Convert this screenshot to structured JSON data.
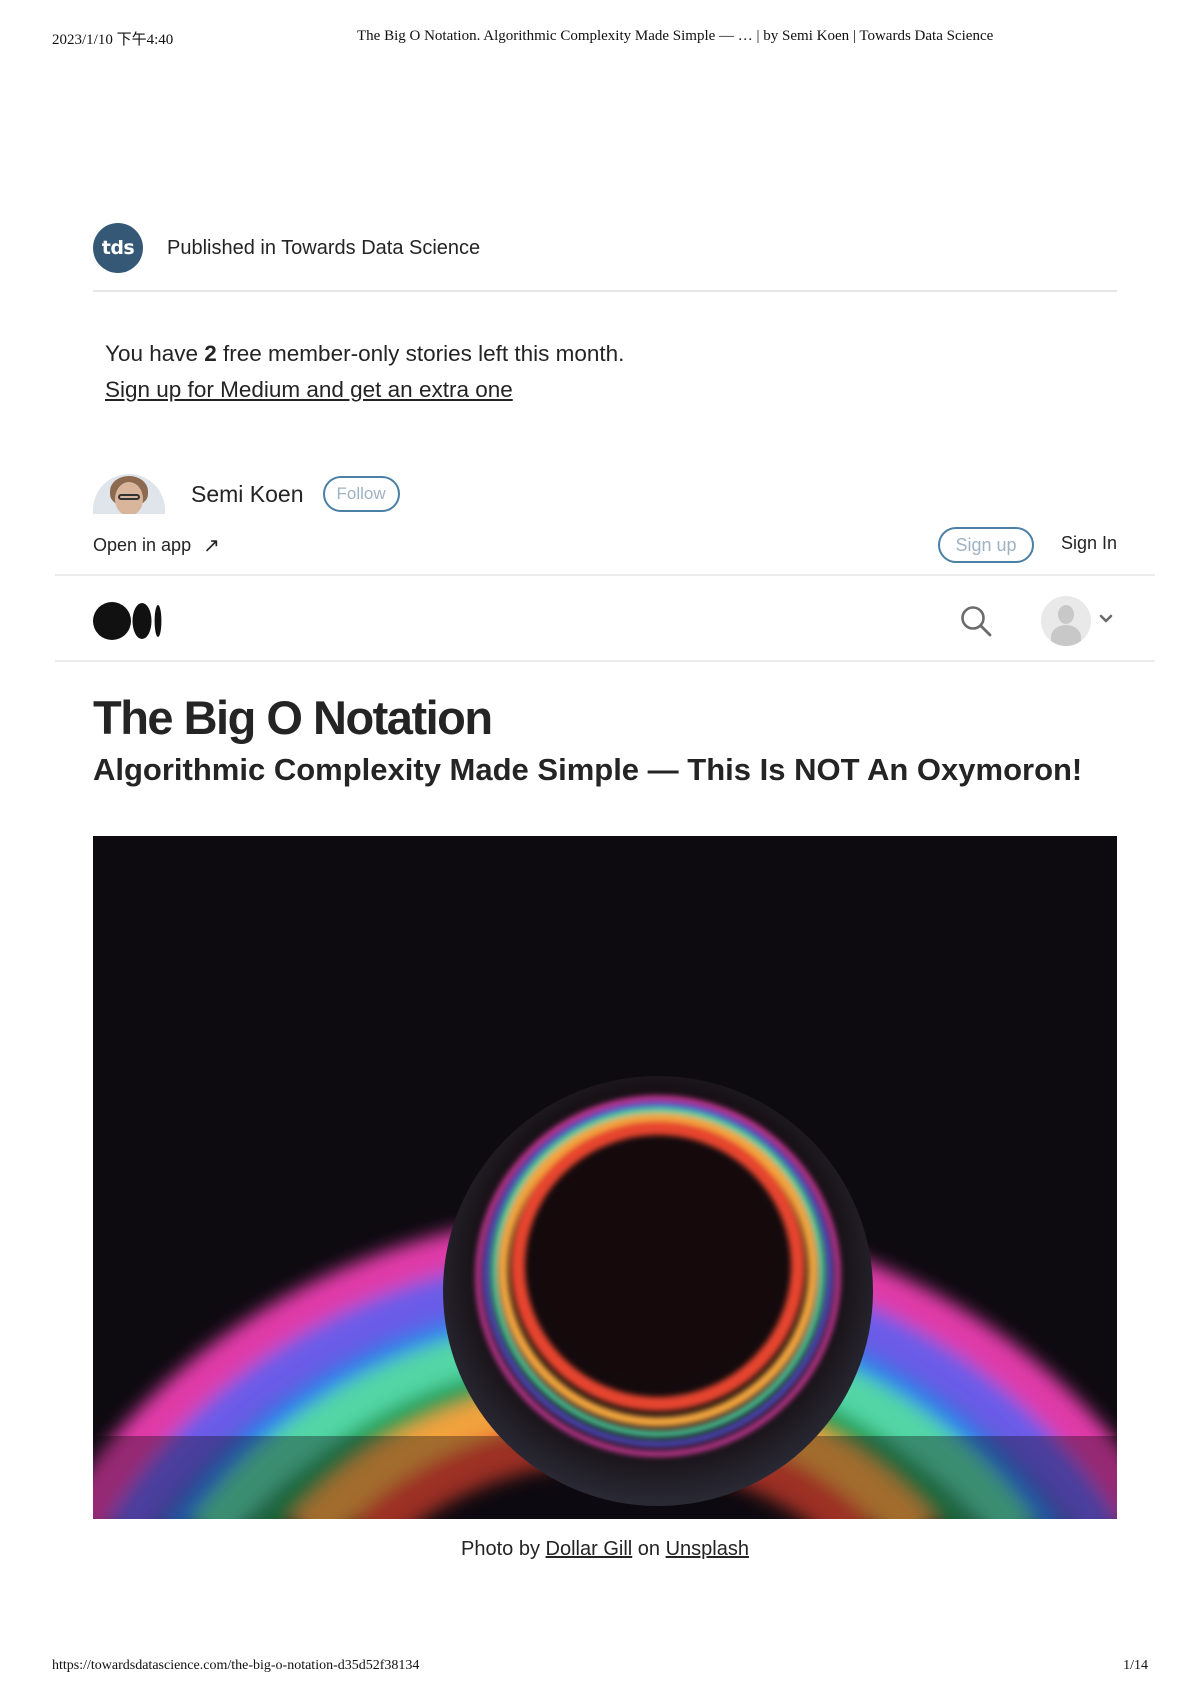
{
  "print_header": {
    "date": "2023/1/10 下午4:40",
    "document_title": "The Big O Notation. Algorithmic Complexity Made Simple — … | by Semi Koen | Towards Data Science"
  },
  "publication": {
    "logo_text": "tds",
    "published_in": "Published in Towards Data Science"
  },
  "paywall": {
    "prefix": "You have ",
    "count": "2",
    "suffix": " free member-only stories left this month.",
    "signup_link": "Sign up for Medium and get an extra one"
  },
  "author": {
    "name": "Semi Koen",
    "follow_label": "Follow"
  },
  "topbar": {
    "open_in_app": "Open in app",
    "arrow_glyph": "↗",
    "sign_up": "Sign up",
    "sign_in": "Sign In"
  },
  "navbar": {
    "logo_icon": "medium-logo",
    "search_icon": "search-icon",
    "user_icon": "user-avatar-icon",
    "menu_icon": "chevron-down-icon"
  },
  "article": {
    "title": "The Big O Notation",
    "subtitle": "Algorithmic Complexity Made Simple — This Is NOT An Oxymoron!"
  },
  "caption": {
    "prefix": "Photo by ",
    "photographer": "Dollar Gill",
    "middle": " on ",
    "source": "Unsplash"
  },
  "print_footer": {
    "url": "https://towardsdatascience.com/the-big-o-notation-d35d52f38134",
    "page": "1/14"
  },
  "colors": {
    "publication_logo": "#355876",
    "outline_button": "#4a7fa6",
    "text": "#242424",
    "hero_background": "#0d0a10"
  }
}
